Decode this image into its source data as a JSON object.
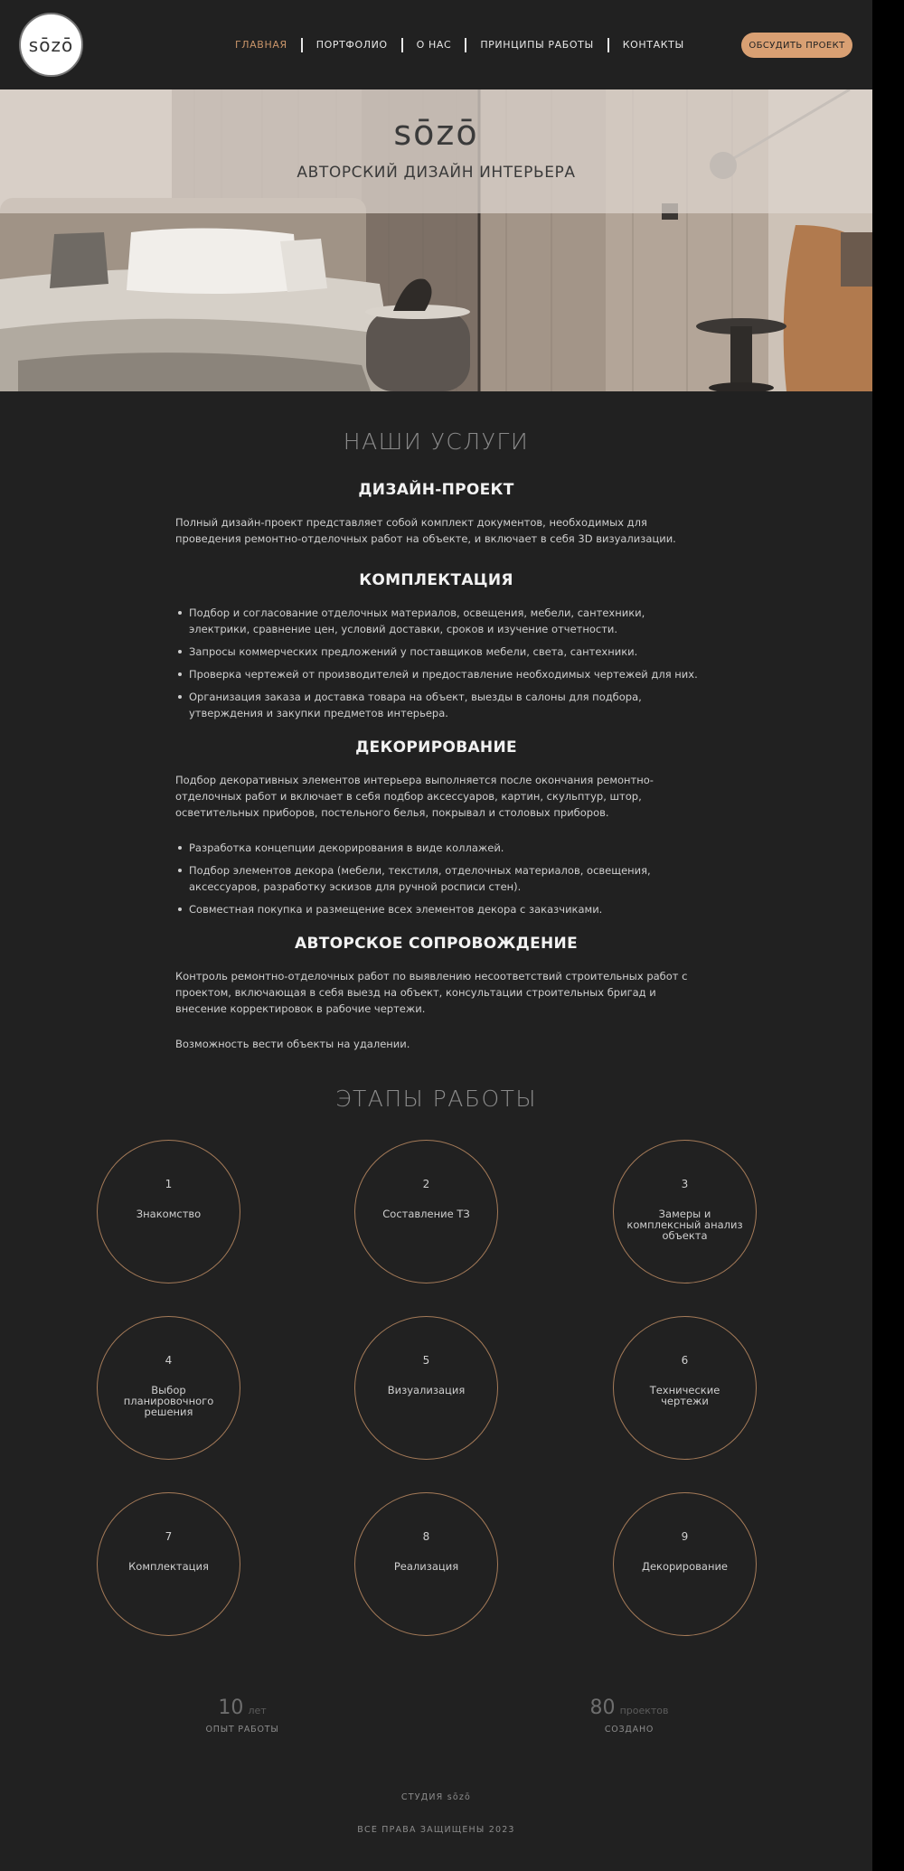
{
  "brand": {
    "logo": "sōzō"
  },
  "nav": {
    "items": [
      "ГЛАВНАЯ",
      "ПОРТФОЛИО",
      "О НАС",
      "ПРИНЦИПЫ РАБОТЫ",
      "КОНТАКТЫ"
    ],
    "active_index": 0
  },
  "cta": {
    "label": "ОБСУДИТЬ ПРОЕКТ"
  },
  "hero": {
    "title": "sōzō",
    "subtitle": "АВТОРСКИЙ ДИЗАЙН ИНТЕРЬЕРА"
  },
  "services": {
    "title": "НАШИ УСЛУГИ",
    "design": {
      "title": "ДИЗАЙН-ПРОЕКТ",
      "text": "Полный дизайн-проект представляет собой комплект документов, необходимых для проведения ремонтно-отделочных работ на объекте, и включает в себя 3D визуализации."
    },
    "equip": {
      "title": "КОМПЛЕКТАЦИЯ",
      "items": [
        "Подбор и согласование отделочных материалов, освещения, мебели, сантехники, электрики, сравнение цен, условий доставки, сроков и изучение отчетности.",
        "Запросы коммерческих предложений у поставщиков мебели, света, сантехники.",
        "Проверка чертежей от производителей и предоставление необходимых чертежей для них.",
        "Организация заказа и доставка товара на объект, выезды в салоны для подбора, утверждения и закупки предметов интерьера."
      ]
    },
    "decor": {
      "title": "ДЕКОРИРОВАНИЕ",
      "text": "Подбор декоративных элементов интерьера выполняется после окончания ремонтно-отделочных работ и включает в себя подбор аксессуаров, картин, скульптур, штор, осветительных приборов, постельного белья, покрывал и столовых приборов.",
      "items": [
        "Разработка концепции декорирования в виде коллажей.",
        "Подбор элементов декора (мебели, текстиля, отделочных материалов, освещения, аксессуаров, разработку эскизов для ручной росписи стен).",
        "Совместная покупка и размещение всех элементов декора с заказчиками."
      ]
    },
    "supervision": {
      "title": "АВТОРСКОЕ СОПРОВОЖДЕНИЕ",
      "text": "Контроль ремонтно-отделочных работ по выявлению несоответствий строительных работ с проектом, включающая в себя выезд на объект, консультации строительных бригад и внесение корректировок в рабочие чертежи.",
      "remote": "Возможность вести объекты на удалении."
    }
  },
  "stages": {
    "title": "ЭТАПЫ РАБОТЫ",
    "items": [
      {
        "num": "1",
        "label": "Знакомство"
      },
      {
        "num": "2",
        "label": "Составление ТЗ"
      },
      {
        "num": "3",
        "label": "Замеры и комплексный анализ объекта"
      },
      {
        "num": "4",
        "label": "Выбор планировочного решения"
      },
      {
        "num": "5",
        "label": "Визуализация"
      },
      {
        "num": "6",
        "label": "Технические чертежи"
      },
      {
        "num": "7",
        "label": "Комплектация"
      },
      {
        "num": "8",
        "label": "Реализация"
      },
      {
        "num": "9",
        "label": "Декорирование"
      }
    ]
  },
  "stats": [
    {
      "num": "10",
      "unit": "лет",
      "caption": "ОПЫТ РАБОТЫ"
    },
    {
      "num": "80",
      "unit": "проектов",
      "caption": "СОЗДАНО"
    }
  ],
  "footer": {
    "studio": "СТУДИЯ sōzō",
    "rights": "ВСЕ ПРАВА ЗАЩИЩЕНЫ 2023"
  },
  "colors": {
    "accent": "#d9a073",
    "circle_border": "#a47a58",
    "background": "#212121"
  }
}
